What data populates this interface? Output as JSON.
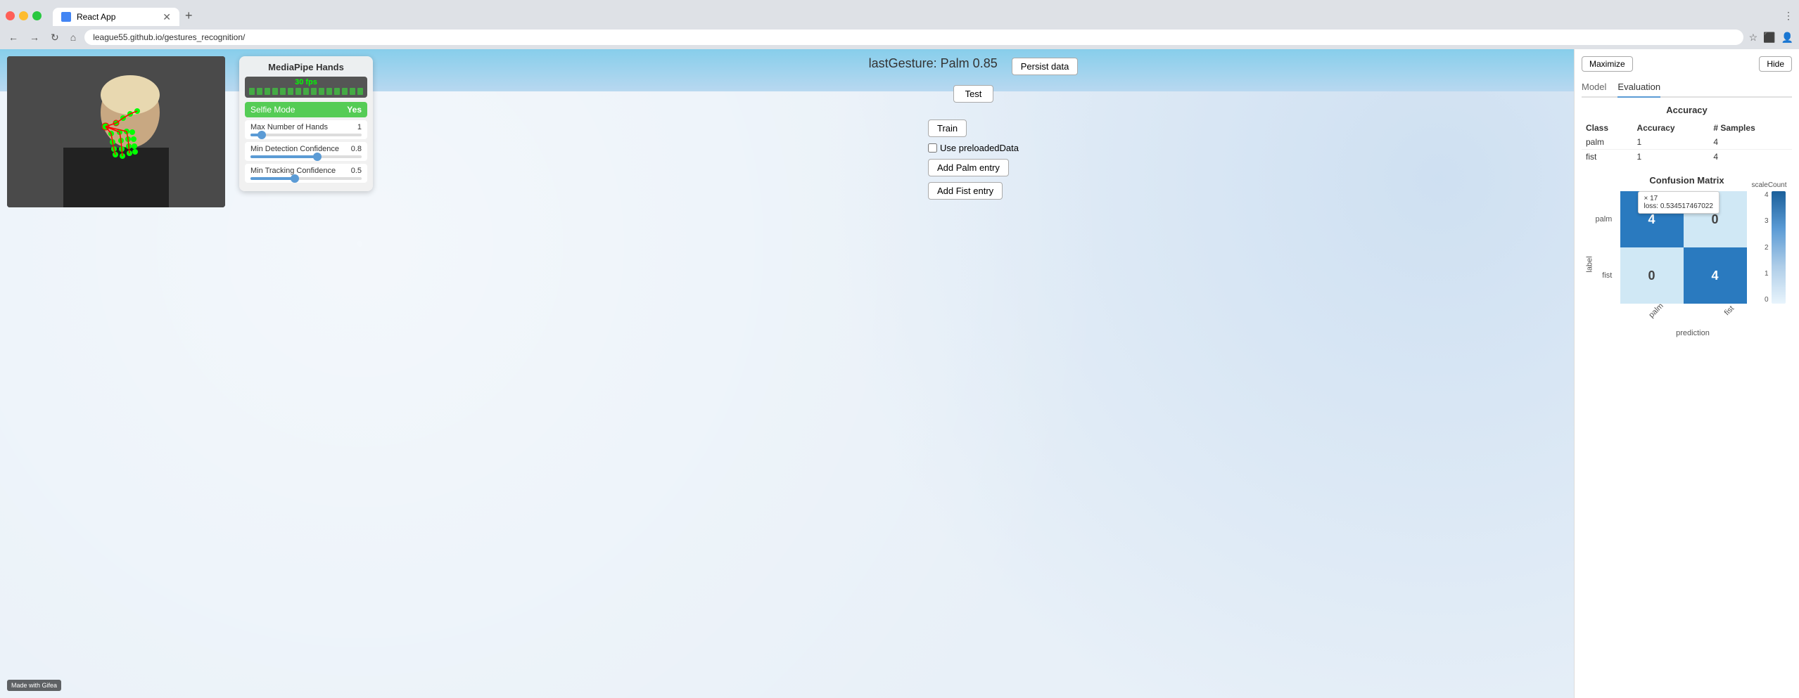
{
  "browser": {
    "tab_title": "React App",
    "url": "league55.github.io/gestures_recognition/",
    "close_icon": "✕",
    "new_tab_icon": "+",
    "back_icon": "←",
    "forward_icon": "→",
    "refresh_icon": "↻",
    "home_icon": "⌂"
  },
  "mediapipe": {
    "panel_title": "MediaPipe Hands",
    "fps": "30 fps",
    "selfie_label": "Selfie Mode",
    "selfie_value": "Yes",
    "sliders": [
      {
        "label": "Max Number of Hands",
        "value": "1",
        "fill_percent": 10
      },
      {
        "label": "Min Detection Confidence",
        "value": "0.8",
        "fill_percent": 60
      },
      {
        "label": "Min Tracking Confidence",
        "value": "0.5",
        "fill_percent": 40
      }
    ]
  },
  "main": {
    "last_gesture": "lastGesture: Palm 0.85",
    "test_button": "Test",
    "persist_button": "Persist data",
    "train_button": "Train",
    "use_preloaded_label": "Use preloadedData",
    "add_palm_button": "Add Palm entry",
    "add_fist_button": "Add Fist entry"
  },
  "right_panel": {
    "maximize_button": "Maximize",
    "hide_button": "Hide",
    "tabs": [
      {
        "label": "Model",
        "active": false
      },
      {
        "label": "Evaluation",
        "active": true
      }
    ],
    "accuracy": {
      "title": "Accuracy",
      "headers": [
        "Class",
        "Accuracy",
        "# Samples"
      ],
      "rows": [
        {
          "class": "palm",
          "accuracy": "1",
          "samples": "4"
        },
        {
          "class": "fist",
          "accuracy": "1",
          "samples": "4"
        }
      ]
    },
    "confusion_matrix": {
      "title": "Confusion Matrix",
      "tooltip": {
        "x": "17",
        "loss": "0.534517467022"
      },
      "cells": [
        {
          "row": 0,
          "col": 0,
          "value": "4",
          "type": "blue-dark"
        },
        {
          "row": 0,
          "col": 1,
          "value": "0",
          "type": "blue-light"
        },
        {
          "row": 1,
          "col": 0,
          "value": "0",
          "type": "blue-light"
        },
        {
          "row": 1,
          "col": 1,
          "value": "4",
          "type": "blue-dark"
        }
      ],
      "y_labels": [
        "palm",
        "fist"
      ],
      "x_labels": [
        "palm",
        "fist"
      ],
      "y_axis_title": "label",
      "x_axis_title": "prediction",
      "scale_labels": [
        "4",
        "3",
        "2",
        "1",
        "0"
      ],
      "scale_title": "scaleCount"
    }
  },
  "gifea_badge": "Made with Gifea"
}
